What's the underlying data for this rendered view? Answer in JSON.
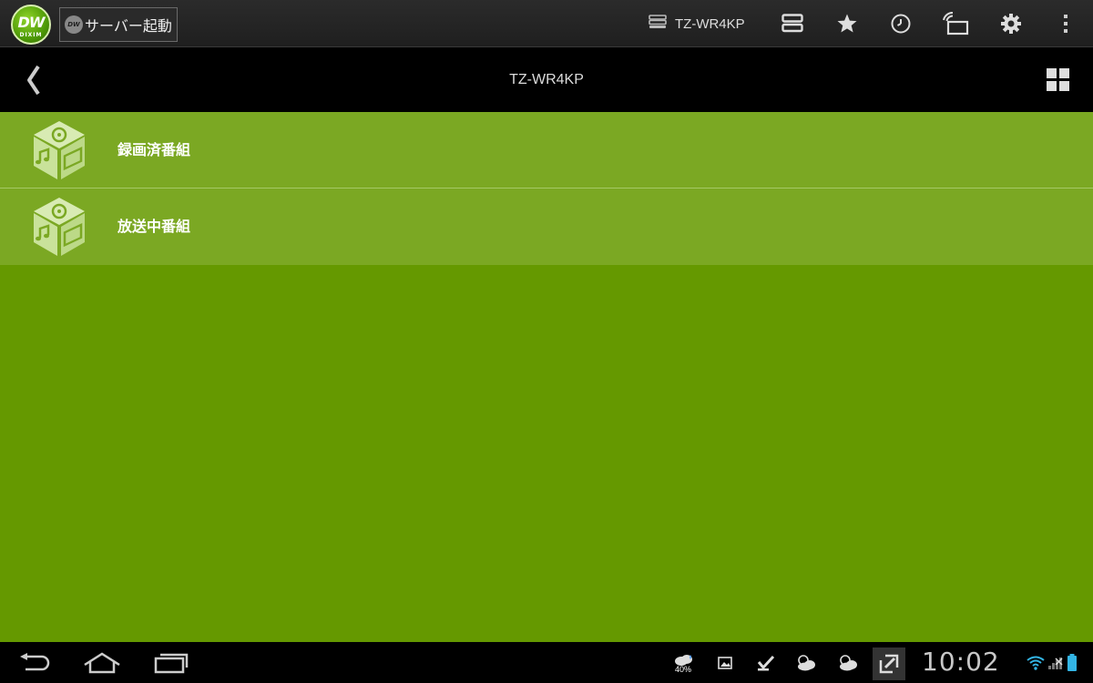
{
  "actionbar": {
    "logo_main": "DW",
    "logo_sub": "DIXIM",
    "server_button_label": "サーバー起動",
    "server_button_logo": "DW",
    "device_name": "TZ-WR4KP",
    "icons": [
      "server-icon",
      "list-icon",
      "star-icon",
      "clock-icon",
      "remote-icon",
      "gear-icon",
      "overflow-menu-icon"
    ]
  },
  "titlebar": {
    "title": "TZ-WR4KP",
    "back_icon": "chevron-left-icon",
    "view_toggle_icon": "grid-view-icon"
  },
  "list": {
    "items": [
      {
        "label": "録画済番組",
        "icon": "media-cube-icon"
      },
      {
        "label": "放送中番組",
        "icon": "media-cube-icon"
      }
    ]
  },
  "colors": {
    "list_item_bg": "#7ba823",
    "content_bg": "#659900",
    "divider": "#a6c866",
    "actionbar_bg": "#242424"
  },
  "navbar": {
    "buttons": [
      "back-icon",
      "home-icon",
      "recent-apps-icon"
    ],
    "weather_percent": "40%",
    "clock": "10:02"
  }
}
